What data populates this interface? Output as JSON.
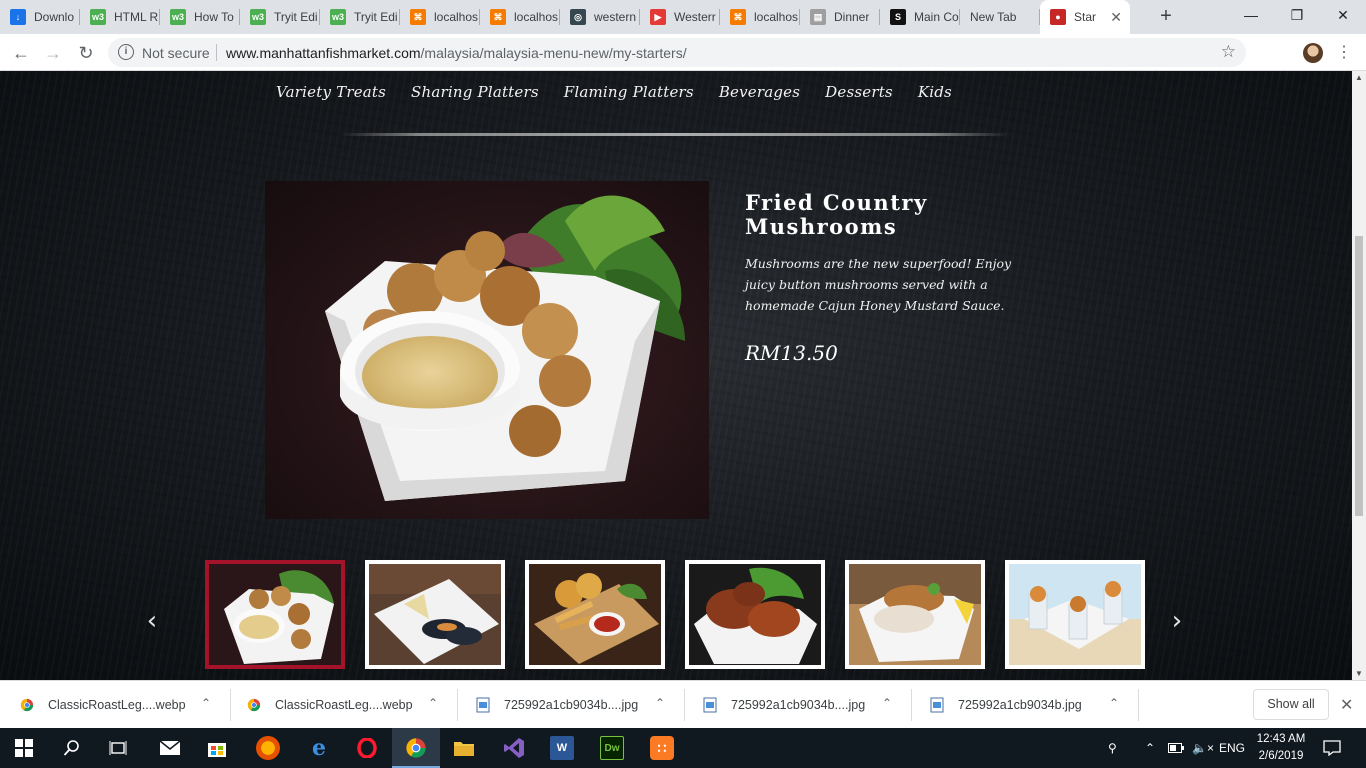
{
  "browser": {
    "tabs": [
      {
        "label": "Downlo",
        "icon": "download-icon",
        "color": "#1a73e8"
      },
      {
        "label": "HTML R",
        "icon": "w3schools-icon",
        "color": "#4caf50"
      },
      {
        "label": "How To",
        "icon": "w3schools-icon",
        "color": "#4caf50"
      },
      {
        "label": "Tryit Edi",
        "icon": "w3schools-icon",
        "color": "#4caf50"
      },
      {
        "label": "Tryit Edi",
        "icon": "w3schools-icon",
        "color": "#4caf50"
      },
      {
        "label": "localhos",
        "icon": "xampp-icon",
        "color": "#f57c00"
      },
      {
        "label": "localhos",
        "icon": "xampp-icon",
        "color": "#f57c00"
      },
      {
        "label": "western",
        "icon": "site-icon",
        "color": "#37474f"
      },
      {
        "label": "Westerr",
        "icon": "play-icon",
        "color": "#e53935"
      },
      {
        "label": "localhos",
        "icon": "xampp-icon",
        "color": "#f57c00"
      },
      {
        "label": "Dinner",
        "icon": "page-icon",
        "color": "#9e9e9e"
      },
      {
        "label": "Main Co",
        "icon": "s-icon",
        "color": "#111111"
      },
      {
        "label": "New Tab",
        "icon": "",
        "color": ""
      },
      {
        "label": "Star",
        "icon": "fish-icon",
        "color": "#c62828"
      }
    ],
    "omnibox": {
      "security": "Not secure",
      "host": "www.manhattanfishmarket.com",
      "path": "/malaysia/malaysia-menu-new/my-starters/"
    }
  },
  "site": {
    "categories": [
      "Variety Treats",
      "Sharing Platters",
      "Flaming Platters",
      "Beverages",
      "Desserts",
      "Kids"
    ],
    "dish": {
      "title": "Fried Country Mushrooms",
      "description": "Mushrooms are the new superfood! Enjoy juicy button mushrooms served with a homemade Cajun Honey Mustard Sauce.",
      "price": "RM13.50"
    },
    "carousel": {
      "prev": "‹",
      "next": "›",
      "thumbnails": [
        "fried-mushrooms",
        "mussels",
        "fish-and-chips",
        "fried-chicken",
        "crispy-onion-bowl",
        "seafood-cups"
      ],
      "selected_index": 0,
      "selected_color": "#a4132a"
    }
  },
  "downloads": {
    "items": [
      {
        "name": "ClassicRoastLeg....webp",
        "icon": "chrome-icon"
      },
      {
        "name": "ClassicRoastLeg....webp",
        "icon": "chrome-icon"
      },
      {
        "name": "725992a1cb9034b....jpg",
        "icon": "image-file-icon"
      },
      {
        "name": "725992a1cb9034b....jpg",
        "icon": "image-file-icon"
      },
      {
        "name": "725992a1cb9034b.jpg",
        "icon": "image-file-icon"
      }
    ],
    "show_all": "Show all"
  },
  "taskbar": {
    "language": "ENG",
    "time": "12:43 AM",
    "date": "2/6/2019"
  }
}
